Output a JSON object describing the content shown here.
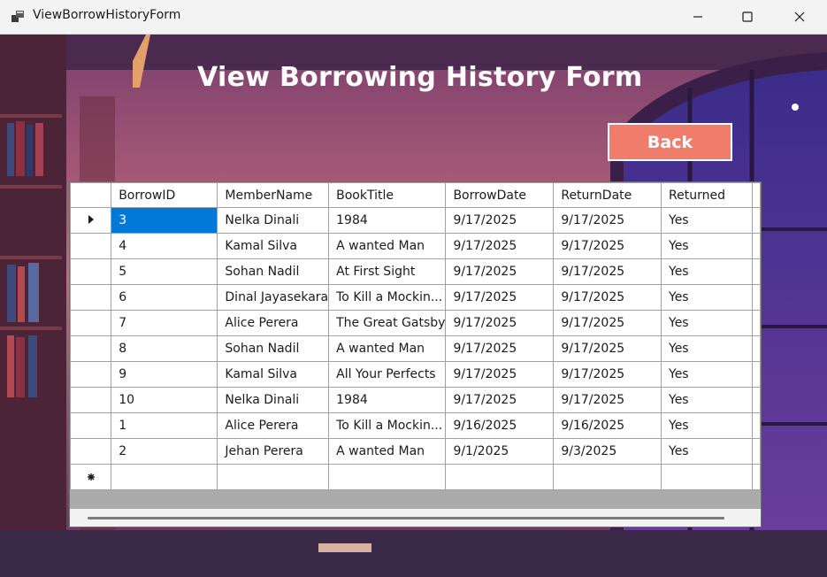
{
  "window": {
    "title": "ViewBorrowHistoryForm",
    "app_icon": "windows-forms-icon",
    "controls": [
      "minimize-icon",
      "maximize-icon",
      "close-icon"
    ]
  },
  "form": {
    "heading": "View Borrowing History Form",
    "back_label": "Back"
  },
  "colors": {
    "back_button": "#f07c6c",
    "selection": "#0078d7",
    "heading_text": "#ffffff"
  },
  "grid": {
    "columns": [
      "BorrowID",
      "MemberName",
      "BookTitle",
      "BorrowDate",
      "ReturnDate",
      "Returned"
    ],
    "current_row_indicator": "row-arrow-icon",
    "new_row_indicator": "new-row-icon",
    "rows": [
      [
        "3",
        "Nelka Dinali",
        "1984",
        "9/17/2025",
        "9/17/2025",
        "Yes"
      ],
      [
        "4",
        "Kamal Silva",
        "A wanted Man",
        "9/17/2025",
        "9/17/2025",
        "Yes"
      ],
      [
        "5",
        "Sohan Nadil",
        "At First Sight",
        "9/17/2025",
        "9/17/2025",
        "Yes"
      ],
      [
        "6",
        "Dinal Jayasekara",
        "To Kill a Mockin...",
        "9/17/2025",
        "9/17/2025",
        "Yes"
      ],
      [
        "7",
        "Alice Perera",
        "The Great Gatsby",
        "9/17/2025",
        "9/17/2025",
        "Yes"
      ],
      [
        "8",
        "Sohan Nadil",
        "A wanted Man",
        "9/17/2025",
        "9/17/2025",
        "Yes"
      ],
      [
        "9",
        "Kamal Silva",
        "All Your Perfects",
        "9/17/2025",
        "9/17/2025",
        "Yes"
      ],
      [
        "10",
        "Nelka Dinali",
        "1984",
        "9/17/2025",
        "9/17/2025",
        "Yes"
      ],
      [
        "1",
        "Alice Perera",
        "To Kill a Mockin...",
        "9/16/2025",
        "9/16/2025",
        "Yes"
      ],
      [
        "2",
        "Jehan Perera",
        "A wanted Man",
        "9/1/2025",
        "9/3/2025",
        "Yes"
      ]
    ]
  }
}
